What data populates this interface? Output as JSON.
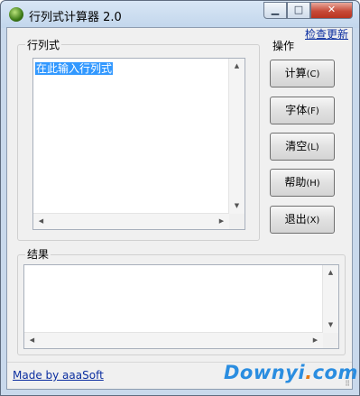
{
  "window": {
    "title": "行列式计算器 2.0",
    "buttons": {
      "minimize": "▁",
      "maximize": "□",
      "close": "✕"
    }
  },
  "header": {
    "update_link": "检查更新"
  },
  "matrix_group": {
    "label": "行列式",
    "input_value": "在此输入行列式"
  },
  "actions": {
    "label": "操作",
    "calc": {
      "label": "计算",
      "accel": "(C)"
    },
    "font": {
      "label": "字体",
      "accel": "(F)"
    },
    "clear": {
      "label": "清空",
      "accel": "(L)"
    },
    "help": {
      "label": "帮助",
      "accel": "(H)"
    },
    "exit": {
      "label": "退出",
      "accel": "(X)"
    }
  },
  "result_group": {
    "label": "结果",
    "value": ""
  },
  "footer": {
    "credit": "Made by aaaSoft"
  },
  "watermark": {
    "text_a": "Downyi",
    "text_dot": ".",
    "text_b": "com"
  },
  "colors": {
    "link": "#0b2ea0",
    "selection": "#3399ff",
    "close_button": "#c74a38",
    "watermark": "#2a8de0"
  }
}
